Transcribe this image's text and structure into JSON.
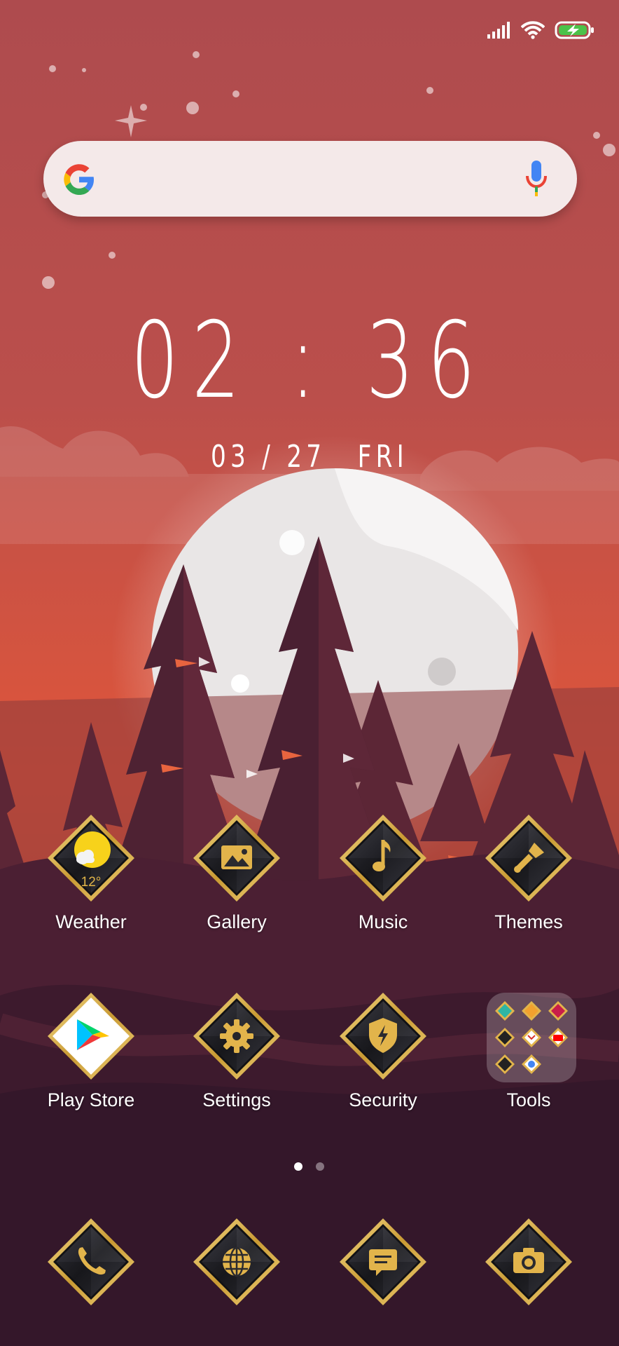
{
  "clock": {
    "time": "02 : 36"
  },
  "date": {
    "day": "03 / 27",
    "weekday": "FRI"
  },
  "search_bar": {
    "logo_icon": "google-g-icon",
    "mic_icon": "microphone-icon"
  },
  "status_bar": {
    "signal_icon": "cell-signal-icon",
    "wifi_icon": "wifi-icon",
    "battery_icon": "battery-charging-icon"
  },
  "apps_row1": [
    {
      "label": "Weather",
      "icon": "weather-icon",
      "temperature": "12°"
    },
    {
      "label": "Gallery",
      "icon": "gallery-icon"
    },
    {
      "label": "Music",
      "icon": "music-note-icon"
    },
    {
      "label": "Themes",
      "icon": "paintbrush-icon"
    }
  ],
  "apps_row2": [
    {
      "label": "Play Store",
      "icon": "play-store-icon"
    },
    {
      "label": "Settings",
      "icon": "gear-icon"
    },
    {
      "label": "Security",
      "icon": "shield-bolt-icon"
    },
    {
      "label": "Tools",
      "icon": "folder-icon"
    }
  ],
  "dock": [
    {
      "icon": "phone-icon"
    },
    {
      "icon": "globe-icon"
    },
    {
      "icon": "message-icon"
    },
    {
      "icon": "camera-icon"
    }
  ],
  "pager": {
    "pages": 2,
    "current": 1
  },
  "colors": {
    "gold": "#d9b24a",
    "sky_top": "#b04c4d",
    "sky_bottom": "#e05a3c",
    "ground": "#35182b"
  }
}
